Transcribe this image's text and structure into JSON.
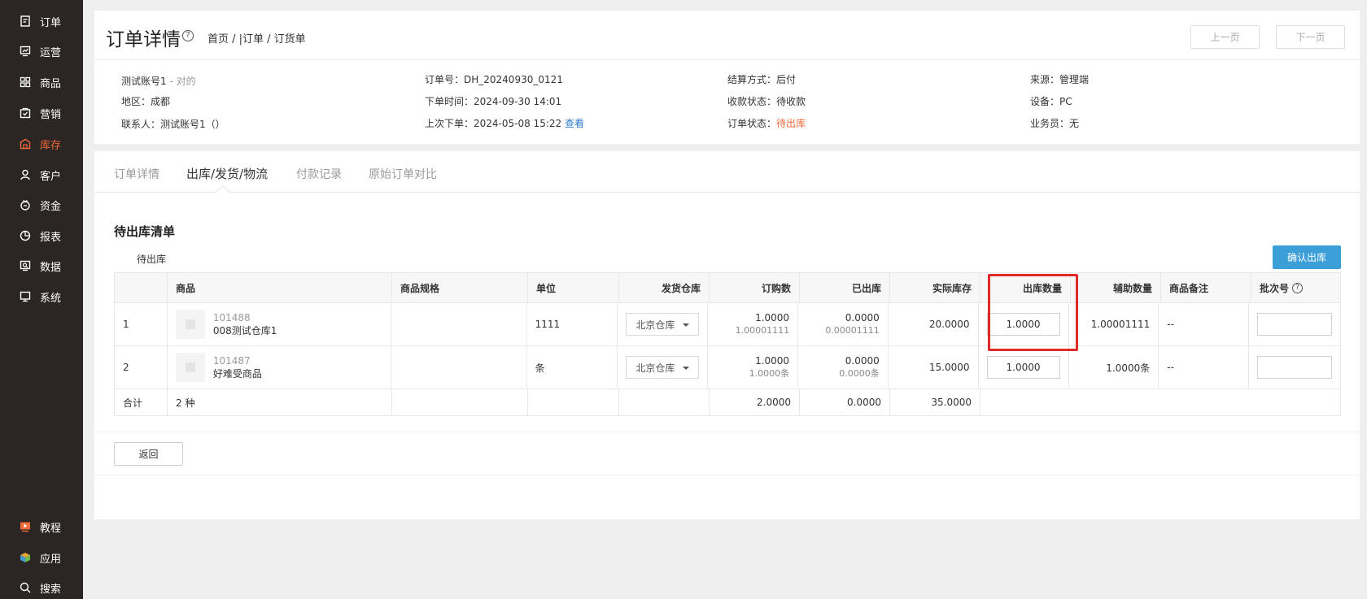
{
  "sidebar": {
    "items": [
      {
        "label": "订单",
        "icon": "order-icon"
      },
      {
        "label": "运营",
        "icon": "operation-icon"
      },
      {
        "label": "商品",
        "icon": "goods-icon"
      },
      {
        "label": "营销",
        "icon": "marketing-icon"
      },
      {
        "label": "库存",
        "icon": "inventory-icon",
        "active": true
      },
      {
        "label": "客户",
        "icon": "customer-icon"
      },
      {
        "label": "资金",
        "icon": "funds-icon"
      },
      {
        "label": "报表",
        "icon": "report-icon"
      },
      {
        "label": "数据",
        "icon": "data-icon"
      },
      {
        "label": "系统",
        "icon": "system-icon"
      }
    ],
    "bottom": [
      {
        "label": "教程",
        "icon": "tutorial-icon"
      },
      {
        "label": "应用",
        "icon": "apps-icon"
      },
      {
        "label": "搜索",
        "icon": "search-icon"
      }
    ],
    "active_color": "#f06a3a"
  },
  "header": {
    "title": "订单详情",
    "help": "?",
    "breadcrumb": "首页 / |订单 / 订货单",
    "prev": "上一页",
    "next": "下一页"
  },
  "info": {
    "account": "测试账号1",
    "account_note": " - 对的",
    "region": "地区：成都",
    "contact": "联系人：测试账号1（）",
    "order_no": "订单号：DH_20240930_0121",
    "order_time": "下单时间：2024-09-30 14:01",
    "last_order": "上次下单：2024-05-08 15:22",
    "view_link": "查看",
    "settle": "结算方式：后付",
    "pay_status": "收款状态：待收款",
    "order_status_label": "订单状态：",
    "order_status": "待出库",
    "source": "来源：管理端",
    "device": "设备：PC",
    "salesman": "业务员：无"
  },
  "tabs": [
    "订单详情",
    "出库/发货/物流",
    "付款记录",
    "原始订单对比"
  ],
  "section": {
    "title": "待出库清单",
    "sub": "待出库",
    "confirm": "确认出库"
  },
  "table": {
    "headers": [
      "",
      "商品",
      "商品规格",
      "单位",
      "发货仓库",
      "订购数",
      "已出库",
      "实际库存",
      "出库数量",
      "辅助数量",
      "商品备注",
      "批次号"
    ],
    "rows": [
      {
        "idx": "1",
        "code": "101488",
        "name": "008测试仓库1",
        "spec": "",
        "unit": "1111",
        "warehouse": "北京仓库",
        "ordered": "1.0000",
        "ordered_sub": "1.00001111",
        "shipped": "0.0000",
        "shipped_sub": "0.00001111",
        "stock": "20.0000",
        "qty": "1.0000",
        "aux": "1.00001111",
        "remark": "--"
      },
      {
        "idx": "2",
        "code": "101487",
        "name": "好难受商品",
        "spec": "",
        "unit": "条",
        "warehouse": "北京仓库",
        "ordered": "1.0000",
        "ordered_sub": "1.0000条",
        "shipped": "0.0000",
        "shipped_sub": "0.0000条",
        "stock": "15.0000",
        "qty": "1.0000",
        "aux": "1.0000条",
        "remark": "--"
      }
    ],
    "total": {
      "label": "合计",
      "kinds": "2 种",
      "ordered": "2.0000",
      "shipped": "0.0000",
      "stock": "35.0000"
    }
  },
  "back": "返回"
}
